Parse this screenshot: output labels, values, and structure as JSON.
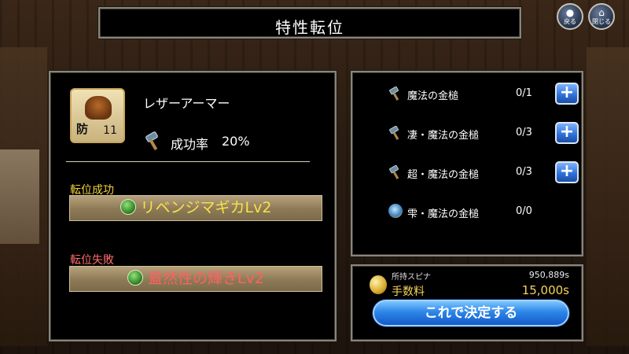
{
  "title": "特性転位",
  "hud": {
    "back_label": "戻る",
    "close_label": "閉じる"
  },
  "item": {
    "name": "レザーアーマー",
    "stat_key": "防",
    "stat_value": "11",
    "icon": "leather-armor-icon"
  },
  "success_rate": {
    "label": "成功率",
    "value": "20%",
    "icon": "hammer-icon"
  },
  "transfer_success": {
    "label": "転位成功",
    "skill": "リベンジマギカLv2",
    "label_color": "#f2d33c",
    "skill_color": "#f5e24a"
  },
  "transfer_failure": {
    "label": "転位失敗",
    "skill": "蓋然性の輝きLv2",
    "label_color": "#ff6b6b",
    "skill_color": "#ff6161"
  },
  "materials": [
    {
      "name": "魔法の金槌",
      "count": "0/1",
      "icon": "hammer-icon",
      "add": "+"
    },
    {
      "name": "凄・魔法の金槌",
      "count": "0/3",
      "icon": "hammer-icon",
      "add": "+"
    },
    {
      "name": "超・魔法の金槌",
      "count": "0/3",
      "icon": "hammer-icon",
      "add": "+"
    },
    {
      "name": "雫・魔法の金槌",
      "count": "0/0",
      "icon": "gem-icon"
    }
  ],
  "fee": {
    "held_label": "所持スピナ",
    "held_value": "950,889s",
    "fee_label": "手数料",
    "fee_value": "15,000s",
    "confirm_label": "これで決定する"
  }
}
